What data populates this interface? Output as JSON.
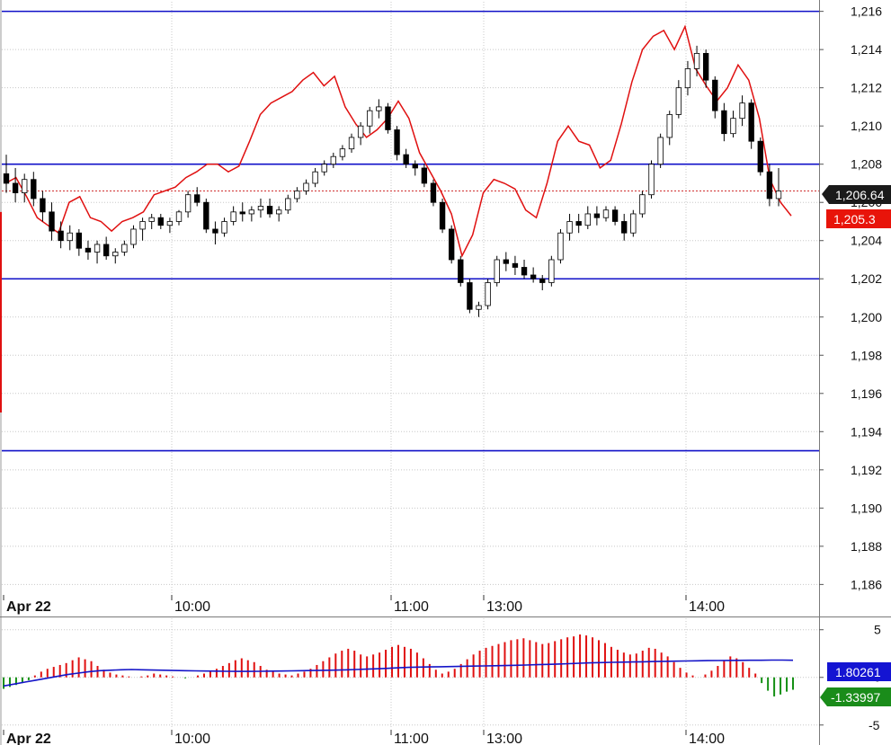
{
  "chart_data": [
    {
      "type": "candlestick",
      "panel": "price",
      "x_ticks": [
        "Apr 22",
        "10:00",
        "11:00",
        "13:00",
        "14:00"
      ],
      "ylim": [
        1.1855,
        1.2165
      ],
      "y_ticks": [
        "1,216",
        "1,214",
        "1,212",
        "1,210",
        "1,208",
        "1,206",
        "1,204",
        "1,202",
        "1,200",
        "1,198",
        "1,196",
        "1,194",
        "1,192",
        "1,190",
        "1,188",
        "1,186"
      ],
      "y_tick_values": [
        1.216,
        1.214,
        1.212,
        1.21,
        1.208,
        1.206,
        1.204,
        1.202,
        1.2,
        1.198,
        1.196,
        1.194,
        1.192,
        1.19,
        1.188,
        1.186
      ],
      "grid": true,
      "horizontal_lines": [
        {
          "value": 1.216,
          "color": "#1010c8"
        },
        {
          "value": 1.208,
          "color": "#1010c8"
        },
        {
          "value": 1.202,
          "color": "#1010c8"
        },
        {
          "value": 1.193,
          "color": "#1010c8"
        }
      ],
      "dashed_line": {
        "value": 1.2066,
        "color": "#d03030"
      },
      "last_price_label": "1,206.64",
      "red_line_label": "1,205.3",
      "candles": [
        [
          1.2075,
          1.2085,
          1.2065,
          1.207
        ],
        [
          1.207,
          1.2078,
          1.206,
          1.2065
        ],
        [
          1.2065,
          1.2075,
          1.206,
          1.2072
        ],
        [
          1.2072,
          1.2076,
          1.2058,
          1.2062
        ],
        [
          1.2062,
          1.2066,
          1.205,
          1.2055
        ],
        [
          1.2055,
          1.206,
          1.204,
          1.2045
        ],
        [
          1.2045,
          1.205,
          1.2036,
          1.204
        ],
        [
          1.204,
          1.2048,
          1.2035,
          1.2044
        ],
        [
          1.2044,
          1.2046,
          1.2032,
          1.2036
        ],
        [
          1.2036,
          1.204,
          1.203,
          1.2034
        ],
        [
          1.2034,
          1.204,
          1.2028,
          1.2038
        ],
        [
          1.2038,
          1.2042,
          1.203,
          1.2032
        ],
        [
          1.2032,
          1.2036,
          1.2028,
          1.2034
        ],
        [
          1.2034,
          1.204,
          1.2032,
          1.2038
        ],
        [
          1.2038,
          1.2048,
          1.2036,
          1.2046
        ],
        [
          1.2046,
          1.2052,
          1.204,
          1.205
        ],
        [
          1.205,
          1.2054,
          1.2046,
          1.2052
        ],
        [
          1.2052,
          1.2054,
          1.2046,
          1.2048
        ],
        [
          1.2048,
          1.2052,
          1.2044,
          1.205
        ],
        [
          1.205,
          1.2056,
          1.2048,
          1.2055
        ],
        [
          1.2055,
          1.2066,
          1.2052,
          1.2064
        ],
        [
          1.2064,
          1.2068,
          1.2058,
          1.206
        ],
        [
          1.206,
          1.2062,
          1.2044,
          1.2046
        ],
        [
          1.2046,
          1.205,
          1.2038,
          1.2044
        ],
        [
          1.2044,
          1.2052,
          1.2042,
          1.205
        ],
        [
          1.205,
          1.2058,
          1.2048,
          1.2055
        ],
        [
          1.2055,
          1.206,
          1.205,
          1.2054
        ],
        [
          1.2054,
          1.2058,
          1.205,
          1.2056
        ],
        [
          1.2056,
          1.2062,
          1.2052,
          1.2058
        ],
        [
          1.2058,
          1.2062,
          1.2052,
          1.2054
        ],
        [
          1.2054,
          1.2058,
          1.205,
          1.2056
        ],
        [
          1.2056,
          1.2064,
          1.2054,
          1.2062
        ],
        [
          1.2062,
          1.2068,
          1.206,
          1.2066
        ],
        [
          1.2066,
          1.2072,
          1.2064,
          1.207
        ],
        [
          1.207,
          1.2078,
          1.2068,
          1.2076
        ],
        [
          1.2076,
          1.2082,
          1.2074,
          1.208
        ],
        [
          1.208,
          1.2086,
          1.2078,
          1.2084
        ],
        [
          1.2084,
          1.209,
          1.2082,
          1.2088
        ],
        [
          1.2088,
          1.2096,
          1.2086,
          1.2094
        ],
        [
          1.2094,
          1.2102,
          1.209,
          1.21
        ],
        [
          1.21,
          1.211,
          1.2096,
          1.2108
        ],
        [
          1.2108,
          1.2114,
          1.2104,
          1.211
        ],
        [
          1.211,
          1.2112,
          1.2096,
          1.2098
        ],
        [
          1.2098,
          1.21,
          1.2082,
          1.2085
        ],
        [
          1.2085,
          1.2088,
          1.2078,
          1.208
        ],
        [
          1.208,
          1.2082,
          1.2074,
          1.2078
        ],
        [
          1.2078,
          1.208,
          1.2068,
          1.207
        ],
        [
          1.207,
          1.2072,
          1.2058,
          1.206
        ],
        [
          1.206,
          1.2062,
          1.2044,
          1.2046
        ],
        [
          1.2046,
          1.2048,
          1.2028,
          1.203
        ],
        [
          1.203,
          1.2032,
          1.2016,
          1.2018
        ],
        [
          1.2018,
          1.202,
          1.2002,
          1.2004
        ],
        [
          1.2004,
          1.2008,
          1.2,
          1.2006
        ],
        [
          1.2006,
          1.202,
          1.2004,
          1.2018
        ],
        [
          1.2018,
          1.2032,
          1.2016,
          1.203
        ],
        [
          1.203,
          1.2034,
          1.2024,
          1.2028
        ],
        [
          1.2028,
          1.2032,
          1.2022,
          1.2026
        ],
        [
          1.2026,
          1.203,
          1.202,
          1.2022
        ],
        [
          1.2022,
          1.2026,
          1.2018,
          1.202
        ],
        [
          1.202,
          1.2022,
          1.2014,
          1.2018
        ],
        [
          1.2018,
          1.2032,
          1.2016,
          1.203
        ],
        [
          1.203,
          1.2046,
          1.2028,
          1.2044
        ],
        [
          1.2044,
          1.2054,
          1.204,
          1.205
        ],
        [
          1.205,
          1.2054,
          1.2044,
          1.2048
        ],
        [
          1.2048,
          1.2058,
          1.2046,
          1.2054
        ],
        [
          1.2054,
          1.2058,
          1.2048,
          1.2052
        ],
        [
          1.2052,
          1.2058,
          1.205,
          1.2056
        ],
        [
          1.2056,
          1.2058,
          1.2048,
          1.205
        ],
        [
          1.205,
          1.2054,
          1.204,
          1.2044
        ],
        [
          1.2044,
          1.2056,
          1.2042,
          1.2054
        ],
        [
          1.2054,
          1.2066,
          1.2052,
          1.2064
        ],
        [
          1.2064,
          1.2082,
          1.2062,
          1.208
        ],
        [
          1.208,
          1.2096,
          1.2078,
          1.2094
        ],
        [
          1.2094,
          1.2108,
          1.209,
          1.2106
        ],
        [
          1.2106,
          1.2124,
          1.2104,
          1.212
        ],
        [
          1.212,
          1.2134,
          1.2116,
          1.213
        ],
        [
          1.213,
          1.2142,
          1.2126,
          1.2138
        ],
        [
          1.2138,
          1.214,
          1.212,
          1.2124
        ],
        [
          1.2124,
          1.2126,
          1.2104,
          1.2108
        ],
        [
          1.2108,
          1.2112,
          1.2092,
          1.2096
        ],
        [
          1.2096,
          1.2108,
          1.2094,
          1.2104
        ],
        [
          1.2104,
          1.2116,
          1.21,
          1.2112
        ],
        [
          1.2112,
          1.2114,
          1.2088,
          1.2092
        ],
        [
          1.2092,
          1.2094,
          1.2074,
          1.2076
        ],
        [
          1.2076,
          1.208,
          1.2058,
          1.2062
        ],
        [
          1.2062,
          1.2078,
          1.2058,
          1.2066
        ]
      ],
      "red_line": [
        1.207,
        1.2073,
        1.2063,
        1.2052,
        1.2048,
        1.2044,
        1.206,
        1.2063,
        1.2052,
        1.205,
        1.2045,
        1.205,
        1.2052,
        1.2055,
        1.2064,
        1.2066,
        1.2068,
        1.2073,
        1.2076,
        1.208,
        1.208,
        1.2076,
        1.2079,
        1.2092,
        1.2106,
        1.2112,
        1.2115,
        1.2118,
        1.2124,
        1.2128,
        1.2121,
        1.2126,
        1.211,
        1.2101,
        1.2094,
        1.2098,
        1.2104,
        1.2113,
        1.2104,
        1.2086,
        1.2076,
        1.2066,
        1.2054,
        1.2032,
        1.2043,
        1.2065,
        1.2072,
        1.207,
        1.2067,
        1.2056,
        1.2052,
        1.207,
        1.2092,
        1.21,
        1.2092,
        1.209,
        1.2078,
        1.2082,
        1.2101,
        1.2123,
        1.214,
        1.2147,
        1.215,
        1.214,
        1.2152,
        1.213,
        1.2121,
        1.2113,
        1.212,
        1.2132,
        1.2124,
        1.2104,
        1.2072,
        1.206,
        1.2053
      ]
    },
    {
      "type": "bar",
      "panel": "oscillator",
      "x_ticks": [
        "Apr 22",
        "10:00",
        "11:00",
        "13:00",
        "14:00"
      ],
      "ylim": [
        -5.4,
        6.2
      ],
      "y_ticks": [
        "5",
        "0",
        "-5"
      ],
      "y_tick_values": [
        5,
        0,
        -5
      ],
      "grid": true,
      "histogram_label": "-1.33997",
      "signal_label": "1.80261",
      "histogram": [
        -1.2,
        -1.0,
        -0.8,
        -0.6,
        -0.3,
        0.2,
        0.6,
        0.9,
        1.1,
        1.3,
        1.5,
        1.8,
        2.1,
        1.9,
        1.7,
        1.2,
        0.8,
        0.5,
        0.3,
        0.2,
        0.1,
        0.0,
        0.1,
        0.2,
        0.4,
        0.3,
        0.2,
        0.1,
        0.0,
        -0.1,
        0.0,
        0.2,
        0.4,
        0.6,
        0.9,
        1.2,
        1.5,
        1.8,
        2.0,
        1.8,
        1.6,
        1.2,
        0.8,
        0.6,
        0.4,
        0.3,
        0.2,
        0.4,
        0.6,
        0.9,
        1.3,
        1.7,
        2.1,
        2.5,
        2.8,
        3.0,
        2.8,
        2.4,
        2.2,
        2.4,
        2.6,
        2.9,
        3.2,
        3.4,
        3.2,
        3.0,
        2.6,
        2.0,
        1.4,
        0.8,
        0.4,
        0.6,
        0.9,
        1.4,
        1.9,
        2.4,
        2.8,
        3.1,
        3.3,
        3.5,
        3.7,
        3.9,
        4.0,
        4.1,
        3.9,
        3.7,
        3.5,
        3.6,
        3.8,
        4.0,
        4.2,
        4.3,
        4.5,
        4.4,
        4.2,
        3.9,
        3.6,
        3.2,
        2.9,
        2.6,
        2.4,
        2.5,
        2.8,
        3.1,
        3.0,
        2.6,
        2.2,
        1.6,
        1.0,
        0.5,
        0.2,
        0.0,
        0.3,
        0.7,
        1.2,
        1.8,
        2.2,
        2.0,
        1.6,
        1.0,
        0.4,
        -0.6,
        -1.4,
        -2.0,
        -1.8,
        -1.5,
        -1.3
      ],
      "signal": [
        -0.9,
        -0.7,
        -0.5,
        -0.3,
        -0.1,
        0.1,
        0.3,
        0.45,
        0.6,
        0.7,
        0.75,
        0.8,
        0.82,
        0.8,
        0.77,
        0.75,
        0.72,
        0.7,
        0.68,
        0.66,
        0.65,
        0.64,
        0.63,
        0.63,
        0.64,
        0.65,
        0.66,
        0.68,
        0.7,
        0.72,
        0.74,
        0.76,
        0.79,
        0.82,
        0.86,
        0.9,
        0.95,
        1.0,
        1.05,
        1.08,
        1.1,
        1.12,
        1.14,
        1.16,
        1.18,
        1.2,
        1.22,
        1.24,
        1.27,
        1.3,
        1.33,
        1.36,
        1.4,
        1.44,
        1.48,
        1.52,
        1.55,
        1.58,
        1.6,
        1.62,
        1.64,
        1.66,
        1.68,
        1.7,
        1.72,
        1.74,
        1.76,
        1.77,
        1.78,
        1.79,
        1.8,
        1.8,
        1.81,
        1.81,
        1.8
      ]
    }
  ]
}
